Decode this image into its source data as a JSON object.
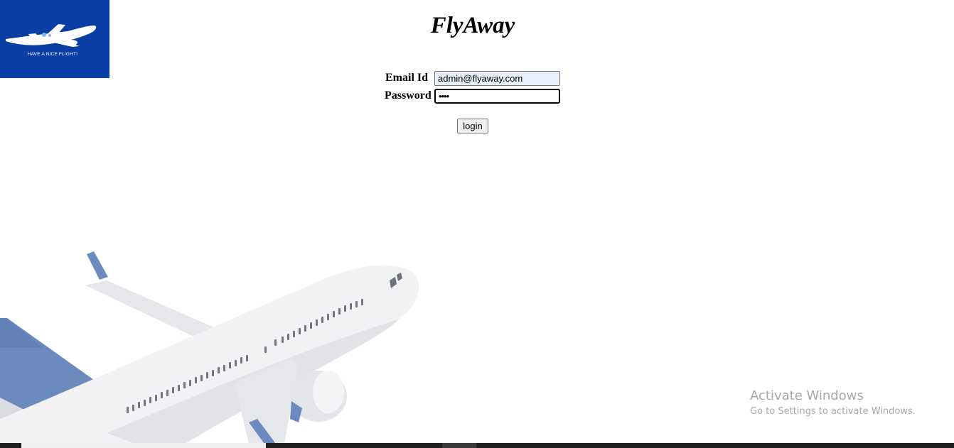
{
  "brand": {
    "logo_tagline": "HAVE A NICE FLIGHT!",
    "site_title": "FlyAway",
    "logo_bg_color": "#0a3ea4"
  },
  "login_form": {
    "email_label": "Email Id",
    "email_value": "admin@flyaway.com",
    "password_label": "Password",
    "password_value": "••••",
    "login_button_label": "login"
  },
  "background": {
    "image": "airplane-illustration",
    "tail_color": "#6b8bbf"
  },
  "os_overlay": {
    "activate_title": "Activate Windows",
    "activate_subtitle": "Go to Settings to activate Windows."
  }
}
